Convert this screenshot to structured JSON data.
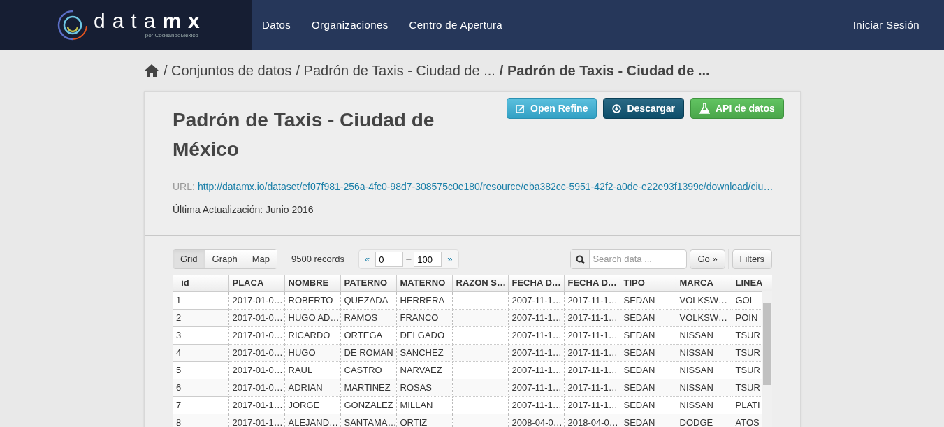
{
  "brand": {
    "name_light": "data",
    "name_bold": "mx",
    "byline": "por CodeandoMéxico"
  },
  "nav": {
    "items": [
      "Datos",
      "Organizaciones",
      "Centro de Apertura"
    ],
    "login": "Iniciar Sesión"
  },
  "breadcrumb": [
    "/ Conjuntos de datos",
    "/ Padrón de Taxis - Ciudad de ...",
    "/ Padrón de Taxis - Ciudad de ..."
  ],
  "resource": {
    "title": "Padrón de Taxis - Ciudad de México",
    "actions": [
      {
        "kind": "refine",
        "label": "Open Refine"
      },
      {
        "kind": "download",
        "label": "Descargar"
      },
      {
        "kind": "api",
        "label": "API de datos"
      }
    ],
    "url_label": "URL:",
    "url": "http://datamx.io/dataset/ef07f981-256a-4fc0-98d7-308575c0e180/resource/eba382cc-5951-42f2-a0de-e22e93f1399c/download/ciu…",
    "updated": "Última Actualización: Junio 2016"
  },
  "explorer": {
    "views": [
      {
        "label": "Grid",
        "selected": true
      },
      {
        "label": "Graph",
        "selected": false
      },
      {
        "label": "Map",
        "selected": false
      }
    ],
    "records": "9500 records",
    "prev": "«",
    "from": "0",
    "dash": "–",
    "to": "100",
    "next": "»",
    "search_placeholder": "Search data ...",
    "go": "Go »",
    "filters": "Filters"
  },
  "table": {
    "columns": [
      "_id",
      "PLACA",
      "NOMBRE",
      "PATERNO",
      "MATERNO",
      "RAZON S…",
      "FECHA D…",
      "FECHA D…",
      "TIPO",
      "MARCA",
      "LINEA"
    ],
    "rows": [
      [
        "1",
        "2017-01-0…",
        "ROBERTO",
        "QUEZADA",
        "HERRERA",
        "",
        "2007-11-1…",
        "2017-11-1…",
        "SEDAN",
        "VOLKSW…",
        "GOL"
      ],
      [
        "2",
        "2017-01-0…",
        "HUGO AD…",
        "RAMOS",
        "FRANCO",
        "",
        "2007-11-1…",
        "2017-11-1…",
        "SEDAN",
        "VOLKSW…",
        "POIN"
      ],
      [
        "3",
        "2017-01-0…",
        "RICARDO",
        "ORTEGA",
        "DELGADO",
        "",
        "2007-11-1…",
        "2017-11-1…",
        "SEDAN",
        "NISSAN",
        "TSUR"
      ],
      [
        "4",
        "2017-01-0…",
        "HUGO",
        "DE ROMAN",
        "SANCHEZ",
        "",
        "2007-11-1…",
        "2017-11-1…",
        "SEDAN",
        "NISSAN",
        "TSUR"
      ],
      [
        "5",
        "2017-01-0…",
        "RAUL",
        "CASTRO",
        "NARVAEZ",
        "",
        "2007-11-1…",
        "2017-11-1…",
        "SEDAN",
        "NISSAN",
        "TSUR"
      ],
      [
        "6",
        "2017-01-0…",
        "ADRIAN",
        "MARTINEZ",
        "ROSAS",
        "",
        "2007-11-1…",
        "2017-11-1…",
        "SEDAN",
        "NISSAN",
        "TSUR"
      ],
      [
        "7",
        "2017-01-1…",
        "JORGE",
        "GONZALEZ",
        "MILLAN",
        "",
        "2007-11-1…",
        "2017-11-1…",
        "SEDAN",
        "NISSAN",
        "PLATI"
      ],
      [
        "8",
        "2017-01-1…",
        "ALEJAND…",
        "SANTAMA…",
        "ORTIZ",
        "",
        "2008-04-0…",
        "2018-04-0…",
        "SEDAN",
        "DODGE",
        "ATOS"
      ]
    ]
  }
}
